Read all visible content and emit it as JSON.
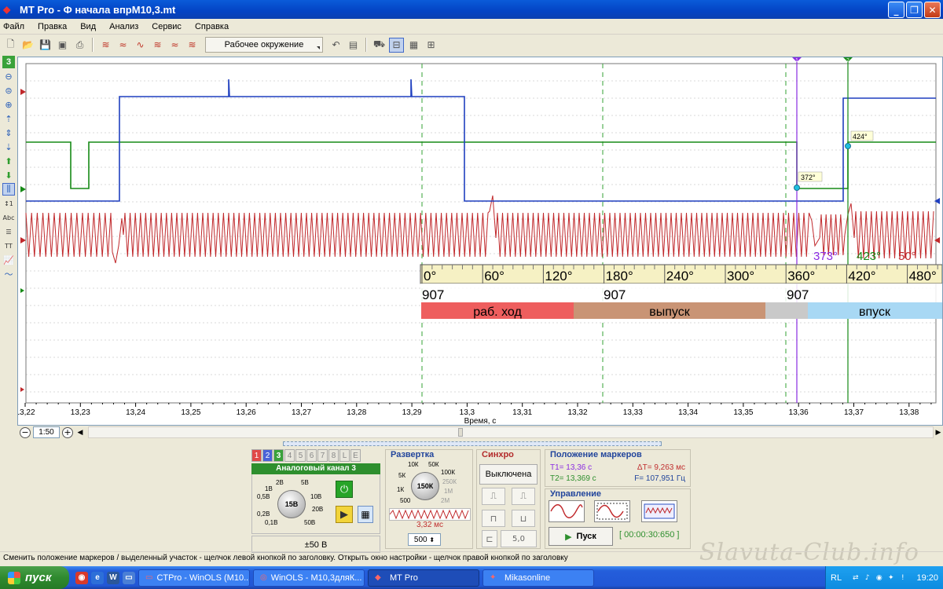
{
  "window": {
    "title": "MT Pro - Ф  начала впрМ10,3.mt"
  },
  "menu": [
    "Файл",
    "Правка",
    "Вид",
    "Анализ",
    "Сервис",
    "Справка"
  ],
  "toolbar": {
    "work_env": "Рабочее окружение"
  },
  "left_toolbar": {
    "channel_num": "3"
  },
  "scope": {
    "x_label": "Время, с",
    "x_ticks": [
      "13,22",
      "13,23",
      "13,24",
      "13,25",
      "13,26",
      "13,27",
      "13,28",
      "13,29",
      "13,3",
      "13,31",
      "13,32",
      "13,33",
      "13,34",
      "13,35",
      "13,36",
      "13,37",
      "13,38"
    ],
    "marker_labels": {
      "m1": "372°",
      "m2": "424°"
    },
    "marker_tags": {
      "t1": "1",
      "t2": "2"
    },
    "angle_readout": {
      "t1": "373°",
      "t2": "423°",
      "delta": "50°"
    },
    "angle_ticks": [
      "0°",
      "60°",
      "120°",
      "180°",
      "240°",
      "300°",
      "360°",
      "420°",
      "480°"
    ],
    "angle_values": [
      "907",
      "907",
      "907"
    ],
    "phases": [
      "раб. ход",
      "выпуск",
      "впуск"
    ],
    "colors": {
      "blue": "#1f3fbf",
      "green": "#168a16",
      "red": "#c0282b",
      "purple": "#8a2be2"
    }
  },
  "scroll": {
    "zoom": "1:50"
  },
  "channel_panel": {
    "tabs": [
      "1",
      "2",
      "3",
      "4",
      "5",
      "6",
      "7",
      "8",
      "L",
      "E"
    ],
    "header": "Аналоговый канал 3",
    "knob_center": "15В",
    "knob_labels": [
      "2В",
      "5В",
      "1В",
      "10В",
      "0,5В",
      "20В",
      "0,2В",
      "50В",
      "0,1В"
    ],
    "range": "±50 В"
  },
  "sweep": {
    "title": "Развертка",
    "knob_center": "150К",
    "knob_labels": [
      "10К",
      "50К",
      "5К",
      "100К",
      "250К",
      "1К",
      "1М",
      "500",
      "2М"
    ],
    "period": "3,32 мс",
    "select": "500"
  },
  "sync": {
    "title": "Синхро",
    "button": "Выключена",
    "level": "5,0"
  },
  "markers": {
    "title": "Положение маркеров",
    "t1": "T1= 13,36 с",
    "dt": "ΔT= 9,263 мс",
    "t2": "T2= 13,369 с",
    "f": "F= 107,951 Гц"
  },
  "control": {
    "title": "Управление",
    "start": "Пуск",
    "timer": "[ 00:00:30:650 ]"
  },
  "status": "Сменить положение маркеров / выделенный участок - щелчок левой кнопкой по заголовку. Открыть окно настройки - щелчок правой кнопкой по заголовку",
  "watermark": "Slavuta-Club.info",
  "taskbar": {
    "start": "пуск",
    "tasks": [
      "CTPro - WinOLS (M10...",
      "WinOLS - M10,3дляК...",
      "MT Pro",
      "Mikasonline"
    ],
    "lang": "RL",
    "clock": "19:20"
  }
}
